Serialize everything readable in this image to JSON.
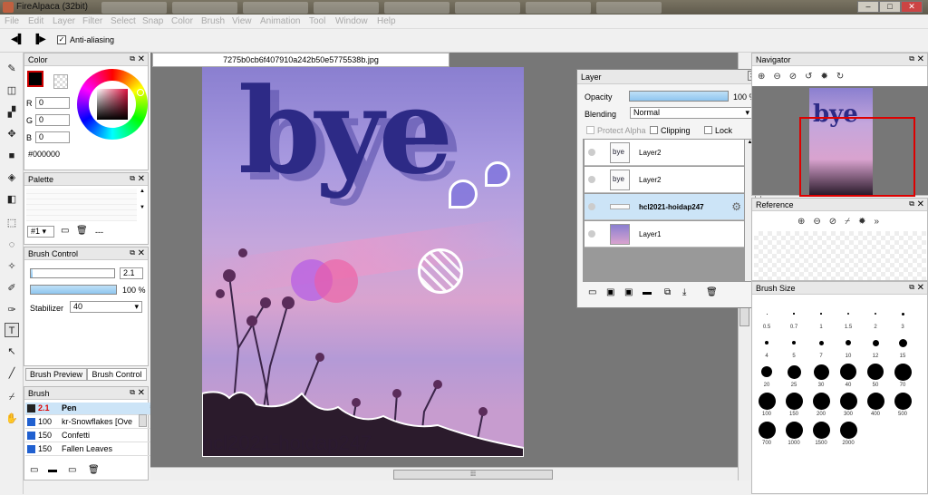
{
  "window": {
    "title": "FireAlpaca (32bit)"
  },
  "menu": [
    "File",
    "Edit",
    "Layer",
    "Filter",
    "Select",
    "Snap",
    "Color",
    "Brush",
    "View",
    "Animation",
    "Tool",
    "Window",
    "Help"
  ],
  "toolbar": {
    "antialias_label": "Anti-aliasing"
  },
  "color_panel": {
    "title": "Color",
    "r_label": "R",
    "g_label": "G",
    "b_label": "B",
    "r": "0",
    "g": "0",
    "b": "0",
    "hex": "#000000"
  },
  "palette_panel": {
    "title": "Palette",
    "selector": "#1",
    "dots": "---"
  },
  "brush_control": {
    "title": "Brush Control",
    "size": "2.1",
    "opacity": "100 %",
    "stabilizer_label": "Stabilizer",
    "stabilizer": "40"
  },
  "brush_tabs": {
    "preview": "Brush Preview",
    "control": "Brush Control"
  },
  "brush_panel": {
    "title": "Brush",
    "items": [
      {
        "size": "2.1",
        "name": "Pen"
      },
      {
        "size": "100",
        "name": "kr-Snowflakes [Ove"
      },
      {
        "size": "150",
        "name": "Confetti"
      },
      {
        "size": "150",
        "name": "Fallen Leaves"
      }
    ]
  },
  "canvas": {
    "tab": "7275b0cb6f407910a242b50e5775538b.jpg",
    "art_title": "bye",
    "watermark": "hcl2021-hoidap247"
  },
  "layer_panel": {
    "title": "Layer",
    "opacity_label": "Opacity",
    "opacity": "100 %",
    "blending_label": "Blending",
    "blending": "Normal",
    "protect_alpha": "Protect Alpha",
    "clipping": "Clipping",
    "lock": "Lock",
    "layers": [
      {
        "name": "Layer2",
        "thumb": "bye"
      },
      {
        "name": "Layer2",
        "thumb": "bye"
      },
      {
        "name": "hcl2021-hoidap247",
        "thumb": ""
      },
      {
        "name": "Layer1",
        "thumb": ""
      }
    ]
  },
  "navigator": {
    "title": "Navigator",
    "thumb_text": "bye"
  },
  "reference": {
    "title": "Reference"
  },
  "brush_size": {
    "title": "Brush Size",
    "sizes": [
      "0.5",
      "0.7",
      "1",
      "1.5",
      "2",
      "3",
      "4",
      "5",
      "7",
      "10",
      "12",
      "15",
      "20",
      "25",
      "30",
      "40",
      "50",
      "70",
      "100",
      "150",
      "200",
      "300",
      "400",
      "500",
      "700",
      "1000",
      "1500",
      "2000"
    ]
  },
  "colors": {
    "accent": "#99ccee",
    "selected_row": "#cce4f7",
    "canvas_bg": "#777777"
  }
}
